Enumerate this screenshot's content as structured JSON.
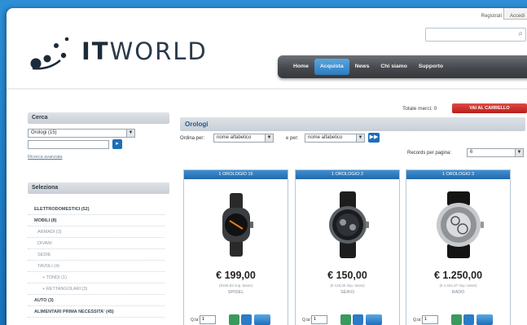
{
  "header": {
    "top_links": [
      "Registrati",
      "Accedi"
    ],
    "logo": {
      "text_bold": "IT",
      "text_rest": "WORLD"
    },
    "search": {
      "placeholder": ""
    },
    "nav": [
      {
        "label": "Home",
        "active": false
      },
      {
        "label": "Acquista",
        "active": true
      },
      {
        "label": "News",
        "active": false
      },
      {
        "label": "Chi siamo",
        "active": false
      },
      {
        "label": "Supporto",
        "active": false
      }
    ]
  },
  "cart": {
    "label": "Totale merci: 0",
    "button_label": "VAI AL CARRELLO"
  },
  "sidebar": {
    "search_panel": {
      "title": "Cerca",
      "select_value": "Orologi (15)",
      "advanced_link": "Ricerca avanzata"
    },
    "categories_panel": {
      "title": "Seleziona",
      "items": [
        {
          "label": "ELETTRODOMESTICI (52)",
          "level": 0
        },
        {
          "label": "MOBILI (8)",
          "level": 0
        },
        {
          "label": "ARMADI (3)",
          "level": 1
        },
        {
          "label": "DIVANI",
          "level": 1
        },
        {
          "label": "SEDIE",
          "level": 1
        },
        {
          "label": "TAVOLI (4)",
          "level": 1
        },
        {
          "label": "+ TONDI (1)",
          "level": 2
        },
        {
          "label": "+ RETTANGOLARI (3)",
          "level": 2
        },
        {
          "label": "AUTO (3)",
          "level": 0
        },
        {
          "label": "ALIMENTARI PRIMA NECESSITA' (45)",
          "level": 0
        }
      ]
    }
  },
  "listing": {
    "title": "Orologi",
    "sort_label": "Ordina per:",
    "sort_value": "nome alfabetico",
    "then_label": "e per:",
    "then_value": "nome alfabetico",
    "per_page_label": "Records per pagina:",
    "per_page_value": "6",
    "products": [
      {
        "title": "1 OROLOGIO 15",
        "price": "€ 199,00",
        "tax": "(€165,83 imp. tasse)",
        "brand": "SPIDEL",
        "qty_label": "Q.ta'",
        "qty": "1"
      },
      {
        "title": "1 OROLOGIO 2",
        "price": "€ 150,00",
        "tax": "(€ 125,00 imp. tasse)",
        "brand": "SEIKO",
        "qty_label": "Q.ta'",
        "qty": "1"
      },
      {
        "title": "1 OROLOGIO 3",
        "price": "€ 1.250,00",
        "tax": "(€ 1.041,67 imp. tasse)",
        "brand": "RADO",
        "qty_label": "Q.ta'",
        "qty": "1"
      }
    ]
  },
  "colors": {
    "accent": "#2269aa",
    "nav": "#45494e",
    "cart_button": "#c2271f",
    "background": "#1f7fc9"
  }
}
